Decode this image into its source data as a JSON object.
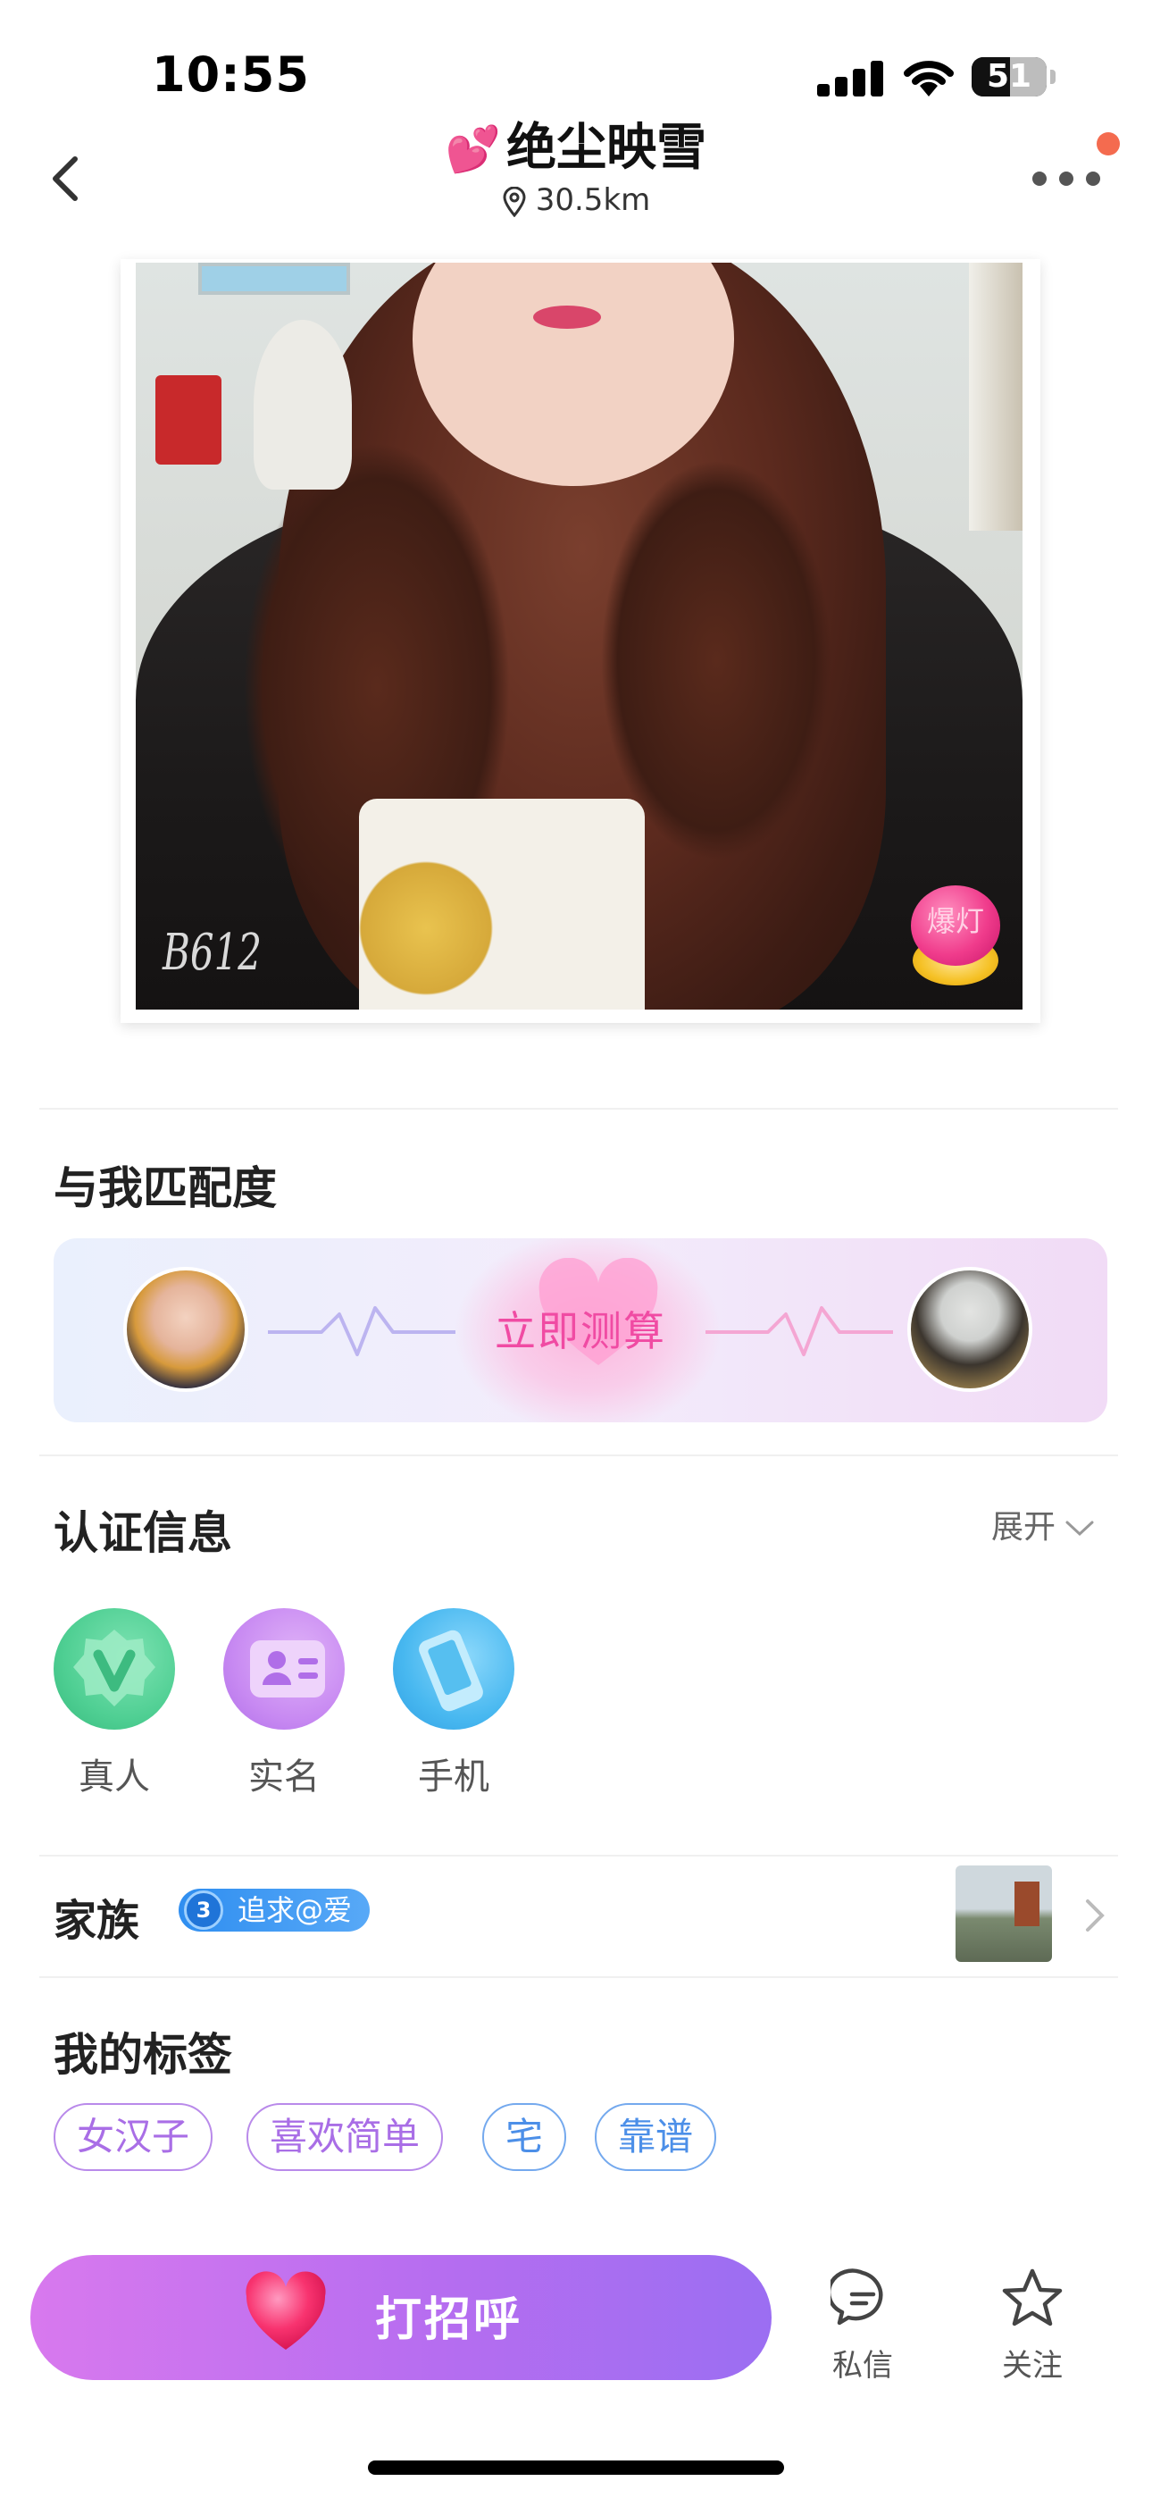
{
  "status_bar": {
    "time": "10:55",
    "battery_level": "51",
    "battery_fraction": 0.51
  },
  "header": {
    "title": "绝尘映雪",
    "title_prefix_icon": "two-hearts-icon",
    "distance": "30.5km",
    "back_icon": "chevron-left-icon",
    "more_icon": "ellipsis-icon",
    "notification_dot_color": "#f46b4f"
  },
  "photo": {
    "watermark": "B612",
    "spotlight_label": "爆灯"
  },
  "match": {
    "title": "与我匹配度",
    "cta": "立即测算",
    "accent_color": "#f04ba3"
  },
  "verification": {
    "title": "认证信息",
    "expand_label": "展开",
    "badges": [
      {
        "label": "真人",
        "icon": "real-person-v-icon",
        "color": "#4fcf93"
      },
      {
        "label": "实名",
        "icon": "id-card-icon",
        "color": "#c88af2"
      },
      {
        "label": "手机",
        "icon": "phone-icon",
        "color": "#48b8f0"
      }
    ]
  },
  "family": {
    "label": "家族",
    "level": "3",
    "name": "追求@爱"
  },
  "tags": {
    "title": "我的标签",
    "items": [
      "女汉子",
      "喜欢简单",
      "宅",
      "靠谱"
    ]
  },
  "bottom_bar": {
    "greet_label": "打招呼",
    "message_label": "私信",
    "follow_label": "关注",
    "greet_gradient": [
      "#d879ee",
      "#9b6ef2"
    ]
  }
}
